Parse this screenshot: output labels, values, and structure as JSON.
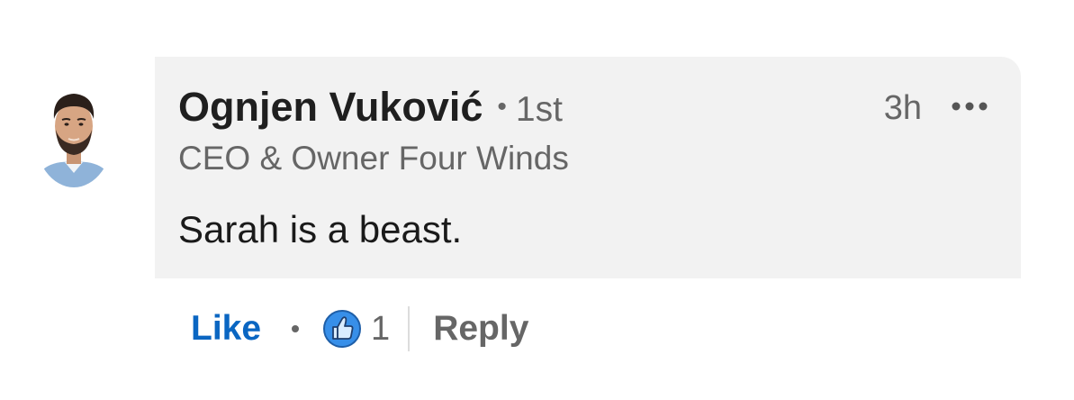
{
  "comment": {
    "author": {
      "name": "Ognjen Vuković",
      "separator": "•",
      "connection_degree": "1st",
      "headline": "CEO & Owner Four Winds"
    },
    "timestamp": "3h",
    "more_icon": "more-horizontal-icon",
    "text": "Sarah is a beast."
  },
  "actions": {
    "like_label": "Like",
    "reaction_icon": "like-reaction-icon",
    "reaction_count": "1",
    "reply_label": "Reply"
  },
  "colors": {
    "bubble_bg": "#f2f2f2",
    "like_blue": "#0a66c2",
    "secondary_text": "#666666",
    "primary_text": "#1a1a1a"
  }
}
